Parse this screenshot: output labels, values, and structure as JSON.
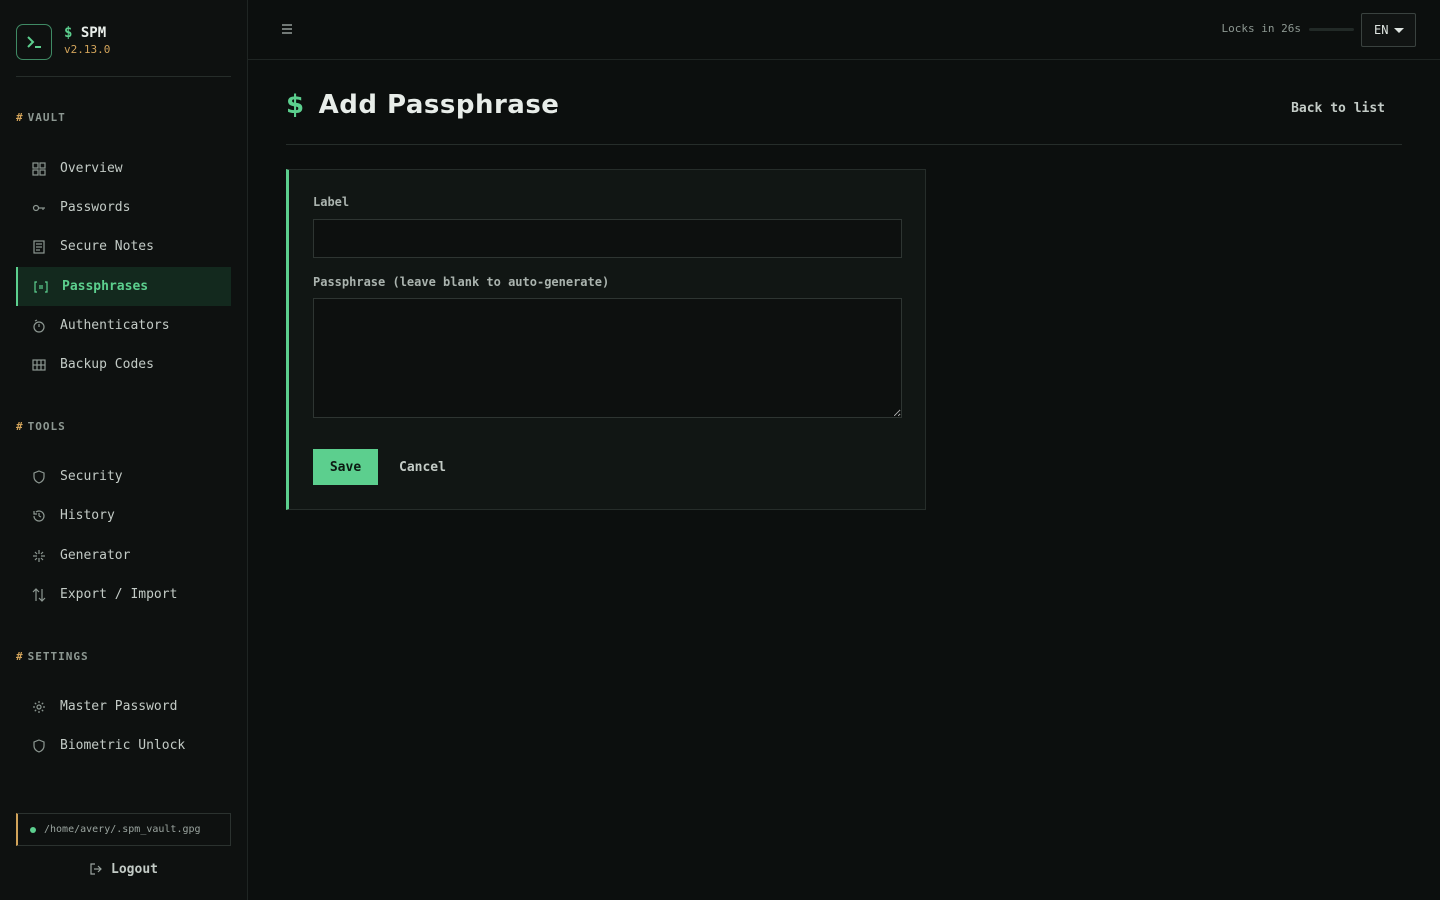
{
  "brand": {
    "name": "SPM",
    "prompt": "$",
    "version": "v2.13.0"
  },
  "sections": {
    "vault": "VAULT",
    "tools": "TOOLS",
    "settings": "SETTINGS",
    "hash": "#"
  },
  "nav": {
    "overview": "Overview",
    "passwords": "Passwords",
    "secure_notes": "Secure Notes",
    "passphrases": "Passphrases",
    "authenticators": "Authenticators",
    "backup_codes": "Backup Codes",
    "security": "Security",
    "history": "History",
    "generator": "Generator",
    "export_import": "Export / Import",
    "master_password": "Master Password",
    "biometric_unlock": "Biometric Unlock"
  },
  "active_nav": "passphrases",
  "vault_path": "/home/avery/.spm_vault.gpg",
  "logout": "Logout",
  "topbar": {
    "lock_text": "Locks in 26s",
    "lock_progress": 0,
    "language": "EN"
  },
  "page": {
    "prompt": "$",
    "title": "Add Passphrase",
    "back_link": "Back to list"
  },
  "form": {
    "label_field": {
      "label": "Label",
      "value": "",
      "placeholder": ""
    },
    "passphrase_field": {
      "label": "Passphrase (leave blank to auto-generate)",
      "value": "",
      "placeholder": ""
    },
    "save": "Save",
    "cancel": "Cancel"
  },
  "colors": {
    "accent": "#5ccf8e",
    "warning": "#d1a35a",
    "background": "#0c0f0e"
  }
}
